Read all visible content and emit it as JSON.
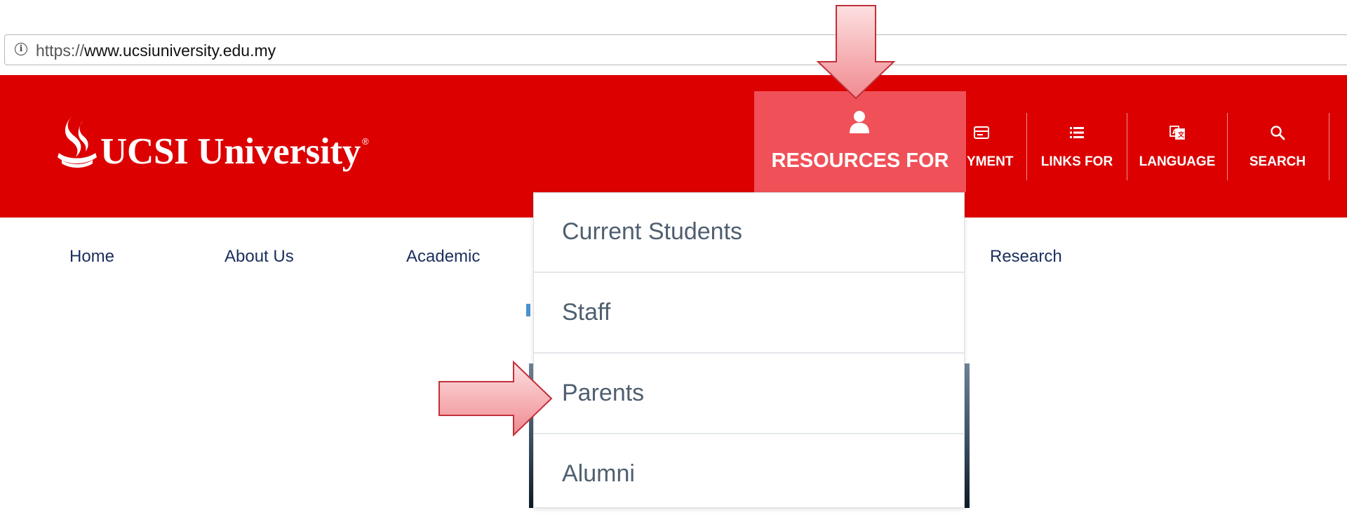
{
  "browser": {
    "url_scheme": "https://",
    "url_host": "www.ucsiuniversity.edu.my",
    "info_icon": "info-circle-icon"
  },
  "header": {
    "background": "#dc0000",
    "logo_text": "UCSI University",
    "logo_reg": "®",
    "resources_label": "RESOURCES FOR",
    "resources_icon": "user-icon",
    "resources_active_color": "#f05058",
    "utility_nav": [
      {
        "label": "YMENT",
        "icon": "card-icon"
      },
      {
        "label": "LINKS FOR",
        "icon": "list-icon"
      },
      {
        "label": "LANGUAGE",
        "icon": "translate-icon"
      },
      {
        "label": "SEARCH",
        "icon": "search-icon"
      }
    ]
  },
  "main_nav": {
    "items": [
      "Home",
      "About Us",
      "Academic",
      "Research"
    ],
    "color": "#1a2e5c"
  },
  "dropdown": {
    "items": [
      "Current Students",
      "Staff",
      "Parents",
      "Alumni"
    ],
    "text_color": "#4f5f70"
  },
  "annotations": {
    "arrow_fill": "#f4a6aa",
    "arrow_stroke": "#c0303a"
  }
}
